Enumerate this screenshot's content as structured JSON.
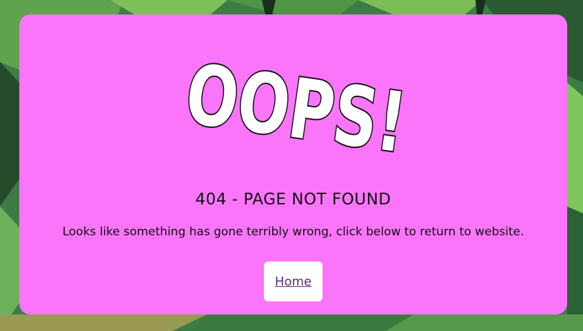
{
  "background": {
    "description": "jungle-leaves",
    "colors": [
      "#2f6b3c",
      "#4e9a4a",
      "#7dbb57",
      "#1f3f27"
    ]
  },
  "card": {
    "color": "#fb75fb"
  },
  "oops": {
    "text": "OOPS!"
  },
  "error": {
    "headline": "404 - PAGE NOT FOUND",
    "message": "Looks like something has gone terribly wrong, click below to return to website."
  },
  "nav": {
    "home_label": "Home"
  }
}
